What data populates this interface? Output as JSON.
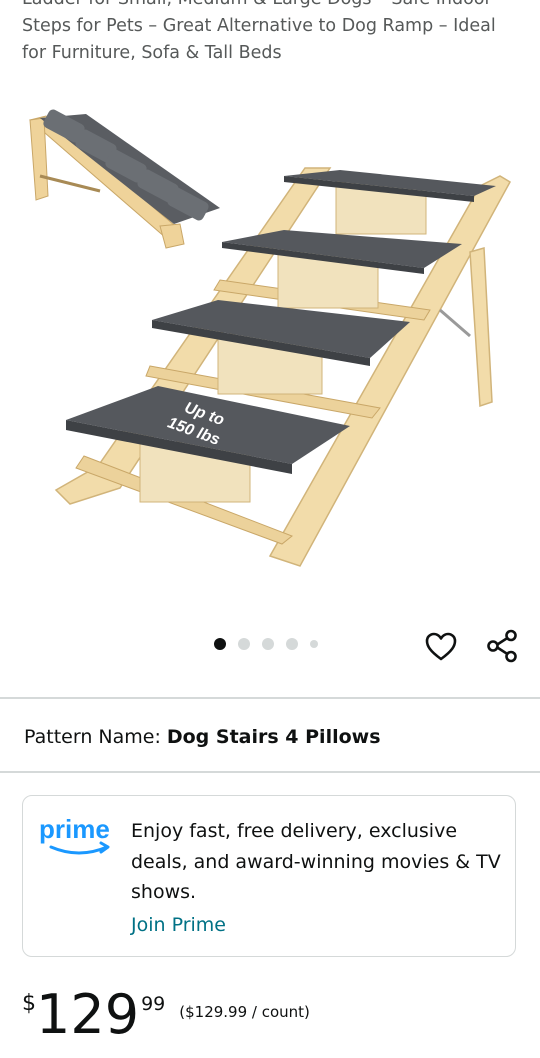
{
  "product": {
    "title_lines": [
      "Ladder for Small, Medium & Large Dogs – Safe Indoor",
      "Steps for Pets – Great Alternative to Dog Ramp – Ideal",
      "for Furniture, Sofa & Tall Beds"
    ],
    "image_badge_line1": "Up to",
    "image_badge_line2": "150 lbs"
  },
  "carousel": {
    "total": 5,
    "active_index": 0
  },
  "icons": {
    "favorite": "heart-icon",
    "share": "share-icon",
    "prime": "prime-logo"
  },
  "pattern": {
    "label": "Pattern Name:",
    "value": "Dog Stairs 4 Pillows"
  },
  "prime": {
    "logo_text": "prime",
    "message": "Enjoy fast, free delivery, exclusive deals, and award-winning movies & TV shows.",
    "link": "Join Prime"
  },
  "price": {
    "currency": "$",
    "whole": "129",
    "fraction": "99",
    "per_unit": "($129.99 / count)"
  },
  "colors": {
    "link": "#007185",
    "prime_blue": "#1a98ff",
    "text": "#0f1111"
  }
}
